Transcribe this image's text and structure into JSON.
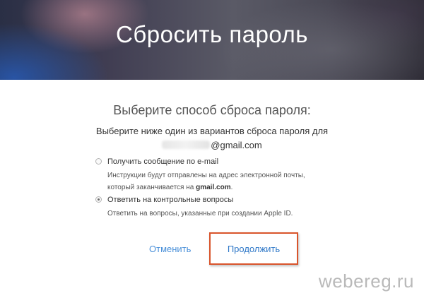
{
  "hero": {
    "title": "Сбросить пароль"
  },
  "form": {
    "heading": "Выберите способ сброса пароля:",
    "intro": "Выберите ниже один из вариантов сброса пароля для",
    "email_domain": "@gmail.com",
    "options": [
      {
        "title": "Получить сообщение по e-mail",
        "desc_prefix": "Инструкции будут отправлены на адрес электронной почты, который заканчивается на",
        "desc_bold": "gmail.com",
        "desc_suffix": ".",
        "selected": false
      },
      {
        "title": "Ответить на контрольные вопросы",
        "desc": "Ответить на вопросы, указанные при создании Apple ID.",
        "selected": true
      }
    ],
    "cancel_label": "Отменить",
    "continue_label": "Продолжить"
  },
  "watermark": "webereg.ru",
  "colors": {
    "link": "#4a90d9",
    "highlight": "#d9542b"
  }
}
